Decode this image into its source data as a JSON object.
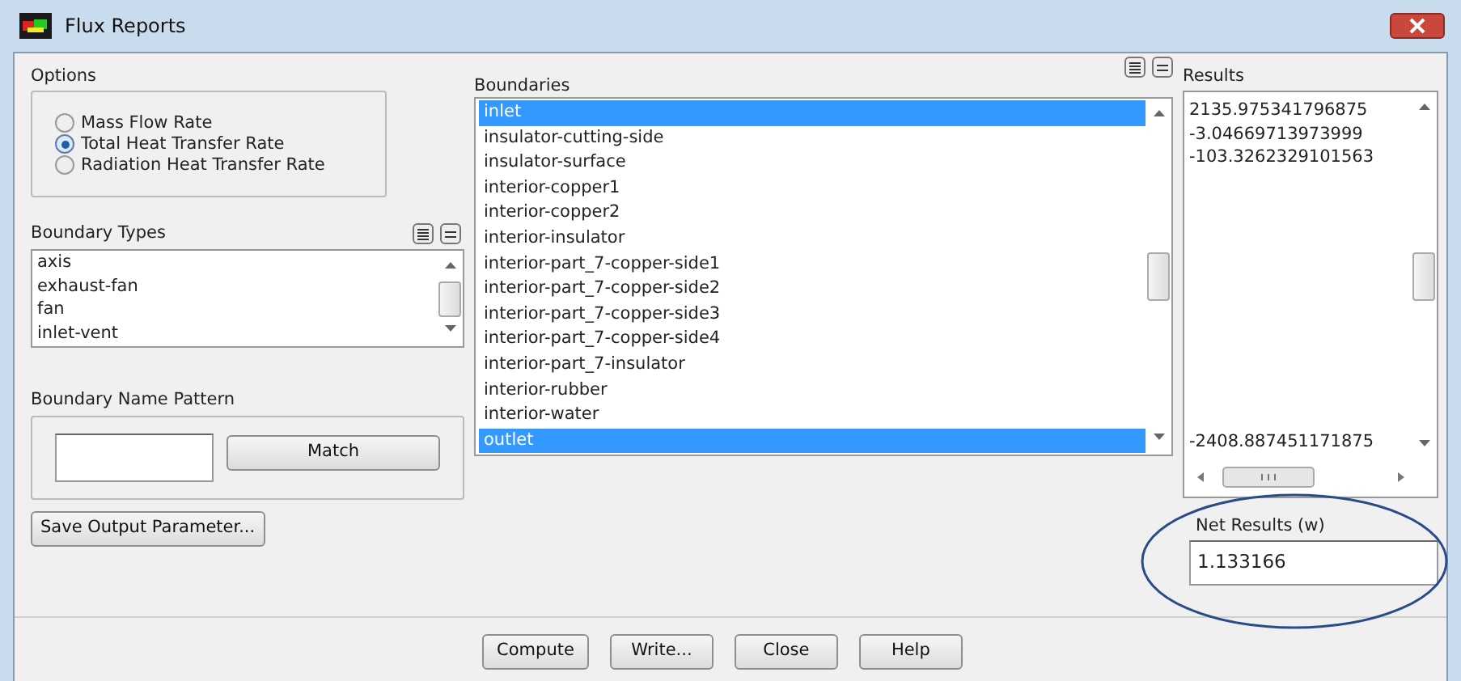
{
  "window": {
    "title": "Flux Reports"
  },
  "options": {
    "label": "Options",
    "items": [
      {
        "label": "Mass Flow Rate",
        "selected": false
      },
      {
        "label": "Total Heat Transfer Rate",
        "selected": true
      },
      {
        "label": "Radiation Heat Transfer Rate",
        "selected": false
      }
    ]
  },
  "boundary_types": {
    "label": "Boundary Types",
    "items": [
      "axis",
      "exhaust-fan",
      "fan",
      "inlet-vent"
    ]
  },
  "boundary_name_pattern": {
    "label": "Boundary Name Pattern",
    "button": "Match"
  },
  "save_button": "Save Output Parameter...",
  "boundaries": {
    "label": "Boundaries",
    "items": [
      {
        "label": "inlet",
        "selected": true
      },
      {
        "label": "insulator-cutting-side",
        "selected": false
      },
      {
        "label": "insulator-surface",
        "selected": false
      },
      {
        "label": "interior-copper1",
        "selected": false
      },
      {
        "label": "interior-copper2",
        "selected": false
      },
      {
        "label": "interior-insulator",
        "selected": false
      },
      {
        "label": "interior-part_7-copper-side1",
        "selected": false
      },
      {
        "label": "interior-part_7-copper-side2",
        "selected": false
      },
      {
        "label": "interior-part_7-copper-side3",
        "selected": false
      },
      {
        "label": "interior-part_7-copper-side4",
        "selected": false
      },
      {
        "label": "interior-part_7-insulator",
        "selected": false
      },
      {
        "label": "interior-rubber",
        "selected": false
      },
      {
        "label": "interior-water",
        "selected": false
      },
      {
        "label": "outlet",
        "selected": true
      }
    ]
  },
  "results": {
    "label": "Results",
    "values": [
      "2135.975341796875",
      "-3.04669713973999",
      "-103.3262329101563",
      "-2408.887451171875"
    ]
  },
  "net_results": {
    "label": "Net Results (w)",
    "value": "1.133166"
  },
  "buttons": [
    "Compute",
    "Write...",
    "Close",
    "Help"
  ]
}
